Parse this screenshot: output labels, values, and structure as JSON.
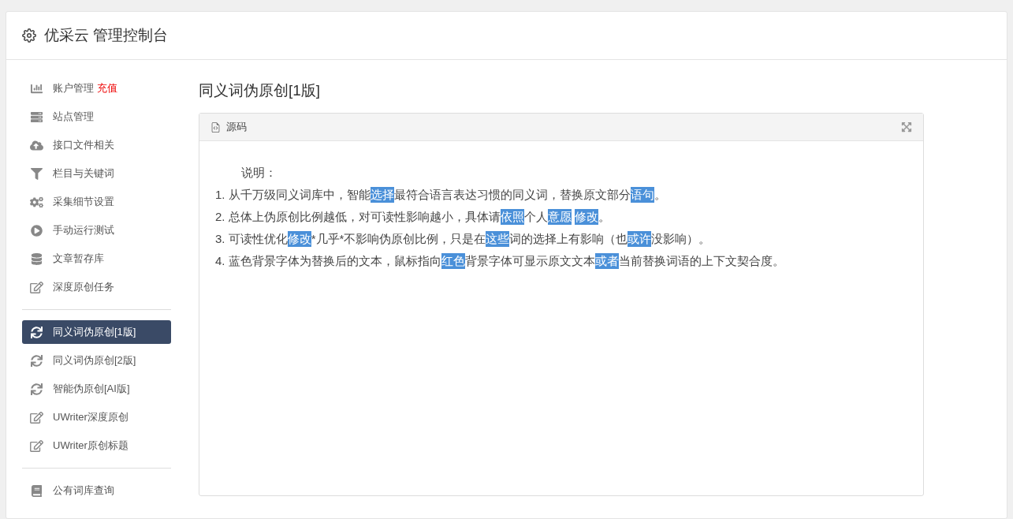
{
  "header": {
    "title": "优采云 管理控制台"
  },
  "sidebar": {
    "groups": [
      {
        "items": [
          {
            "kind": "chart",
            "label": "账户管理",
            "badge": "充值",
            "selected": false
          },
          {
            "kind": "server",
            "label": "站点管理",
            "selected": false
          },
          {
            "kind": "cloud",
            "label": "接口文件相关",
            "selected": false
          },
          {
            "kind": "filter",
            "label": "栏目与关键词",
            "selected": false
          },
          {
            "kind": "cogs",
            "label": "采集细节设置",
            "selected": false
          },
          {
            "kind": "play",
            "label": "手动运行测试",
            "selected": false
          },
          {
            "kind": "database",
            "label": "文章暂存库",
            "selected": false
          },
          {
            "kind": "edit",
            "label": "深度原创任务",
            "selected": false
          }
        ]
      },
      {
        "items": [
          {
            "kind": "sync",
            "label": "同义词伪原创[1版]",
            "selected": true
          },
          {
            "kind": "sync",
            "label": "同义词伪原创[2版]",
            "selected": false
          },
          {
            "kind": "sync",
            "label": "智能伪原创[AI版]",
            "selected": false
          },
          {
            "kind": "edit",
            "label": "UWriter深度原创",
            "selected": false
          },
          {
            "kind": "edit",
            "label": "UWriter原创标题",
            "selected": false
          }
        ]
      },
      {
        "items": [
          {
            "kind": "book",
            "label": "公有词库查询",
            "selected": false
          }
        ]
      }
    ]
  },
  "main": {
    "title": "同义词伪原创[1版]",
    "panel": {
      "tab": "源码",
      "intro": "说明：",
      "lines": [
        [
          {
            "text": "1. 从千万级同义词库中，智能",
            "highlighted": false
          },
          {
            "text": "选择",
            "highlighted": true
          },
          {
            "text": "最符合语言表达习惯的同义词，替换原文部分",
            "highlighted": false
          },
          {
            "text": "语句",
            "highlighted": true
          },
          {
            "text": "。",
            "highlighted": false
          }
        ],
        [
          {
            "text": "2. 总体上伪原创比例越低，对可读性影响越小，具体请",
            "highlighted": false
          },
          {
            "text": "依照",
            "highlighted": true
          },
          {
            "text": "个人",
            "highlighted": false
          },
          {
            "text": "意愿",
            "highlighted": true
          },
          {
            "text": "修改",
            "highlighted": true
          },
          {
            "text": "。",
            "highlighted": false
          }
        ],
        [
          {
            "text": "3. 可读性优化",
            "highlighted": false
          },
          {
            "text": "修改",
            "highlighted": true
          },
          {
            "text": "*几乎*不影响伪原创比例，只是在",
            "highlighted": false
          },
          {
            "text": "这些",
            "highlighted": true
          },
          {
            "text": "词的选择上有影响（也",
            "highlighted": false
          },
          {
            "text": "或许",
            "highlighted": true
          },
          {
            "text": "没影响）。",
            "highlighted": false
          }
        ],
        [
          {
            "text": "4. 蓝色背景字体为替换后的文本，鼠标指向",
            "highlighted": false
          },
          {
            "text": "红色",
            "highlighted": true
          },
          {
            "text": "背景字体可显示原文文本",
            "highlighted": false
          },
          {
            "text": "或者",
            "highlighted": true
          },
          {
            "text": "当前替换词语的上下文契合度。",
            "highlighted": false
          }
        ]
      ]
    }
  }
}
